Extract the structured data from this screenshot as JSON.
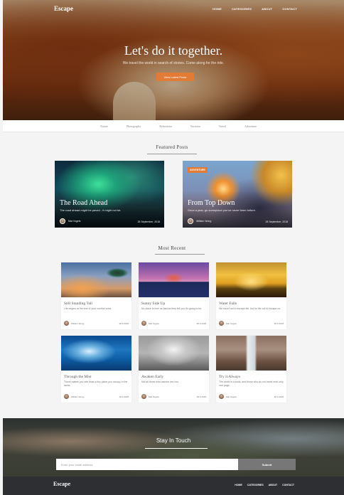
{
  "site": {
    "logo": "Escape"
  },
  "nav": [
    "HOME",
    "CATEGORIES",
    "ABOUT",
    "CONTACT"
  ],
  "hero": {
    "title": "Let's do it together.",
    "subtitle": "We travel the world in search of stories. Come along for the ride.",
    "button": "View Latest Posts"
  },
  "categories": [
    "Nature",
    "Photography",
    "Relaxation",
    "Vacation",
    "Travel",
    "Adventure"
  ],
  "featured": {
    "heading": "Featured Posts",
    "posts": [
      {
        "title": "The Road Ahead",
        "desc": "The road ahead might be paved - it might not be.",
        "author": "Mat Vogels",
        "date": "28 September, 2018",
        "badge": ""
      },
      {
        "title": "From Top Down",
        "desc": "Once a year, go someplace you've never been before.",
        "author": "William Wong",
        "date": "28 September, 2018",
        "badge": "ADVENTURE"
      }
    ]
  },
  "recent": {
    "heading": "Most Recent",
    "posts": [
      {
        "title": "Still Standing Tall",
        "desc": "Life begins at the end of your comfort zone.",
        "author": "William Wong",
        "date": "28.9.2018"
      },
      {
        "title": "Sunny Side Up",
        "desc": "No place is ever as bad as they tell you it's going to be.",
        "author": "Mat Vogels",
        "date": "28.9.2018"
      },
      {
        "title": "Water Falls",
        "desc": "We travel not to escape life, but for life not to escape us.",
        "author": "Mat Vogels",
        "date": "28.9.2018"
      },
      {
        "title": "Through the Mist",
        "desc": "Travel makes you see what a tiny place you occupy in the world.",
        "author": "William Wong",
        "date": "28.9.2018"
      },
      {
        "title": "Awaken Early",
        "desc": "Not all those who wander are lost.",
        "author": "Mat Vogels",
        "date": "28.9.2018"
      },
      {
        "title": "Try it Always",
        "desc": "The world is a book, and those who do not travel read only one page.",
        "author": "Mat Vogels",
        "date": "28.9.2018"
      }
    ]
  },
  "newsletter": {
    "title": "Stay In Touch",
    "placeholder": "Enter your email address",
    "button": "Submit"
  },
  "footer": {
    "logo": "Escape",
    "nav": [
      "HOME",
      "CATEGORIES",
      "ABOUT",
      "CONTACT"
    ]
  },
  "colors": {
    "accent": "#e27b35",
    "footer_bg": "#2d2f33",
    "submit_bg": "#777777"
  }
}
